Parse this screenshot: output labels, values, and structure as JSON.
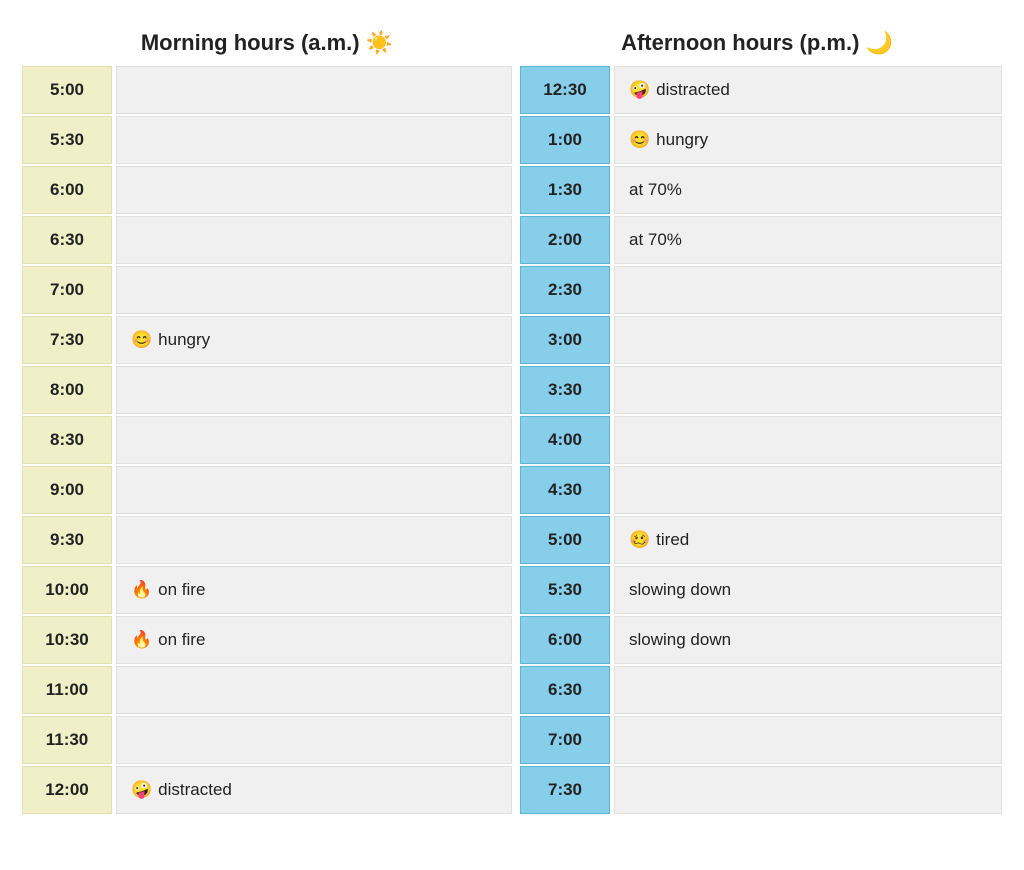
{
  "headers": {
    "morning": "Morning hours (a.m.) ☀️",
    "afternoon": "Afternoon hours (p.m.) 🌙"
  },
  "morning_rows": [
    {
      "time": "5:00",
      "note": "",
      "emoji": ""
    },
    {
      "time": "5:30",
      "note": "",
      "emoji": ""
    },
    {
      "time": "6:00",
      "note": "",
      "emoji": ""
    },
    {
      "time": "6:30",
      "note": "",
      "emoji": ""
    },
    {
      "time": "7:00",
      "note": "",
      "emoji": ""
    },
    {
      "time": "7:30",
      "note": "hungry",
      "emoji": "😊"
    },
    {
      "time": "8:00",
      "note": "",
      "emoji": ""
    },
    {
      "time": "8:30",
      "note": "",
      "emoji": ""
    },
    {
      "time": "9:00",
      "note": "",
      "emoji": ""
    },
    {
      "time": "9:30",
      "note": "",
      "emoji": ""
    },
    {
      "time": "10:00",
      "note": "on fire",
      "emoji": "🔥"
    },
    {
      "time": "10:30",
      "note": "on fire",
      "emoji": "🔥"
    },
    {
      "time": "11:00",
      "note": "",
      "emoji": ""
    },
    {
      "time": "11:30",
      "note": "",
      "emoji": ""
    },
    {
      "time": "12:00",
      "note": "distracted",
      "emoji": "🤪"
    }
  ],
  "afternoon_rows": [
    {
      "time": "12:30",
      "note": "distracted",
      "emoji": "🤪"
    },
    {
      "time": "1:00",
      "note": "hungry",
      "emoji": "😊"
    },
    {
      "time": "1:30",
      "note": "at 70%",
      "emoji": ""
    },
    {
      "time": "2:00",
      "note": "at 70%",
      "emoji": ""
    },
    {
      "time": "2:30",
      "note": "",
      "emoji": ""
    },
    {
      "time": "3:00",
      "note": "",
      "emoji": ""
    },
    {
      "time": "3:30",
      "note": "",
      "emoji": ""
    },
    {
      "time": "4:00",
      "note": "",
      "emoji": ""
    },
    {
      "time": "4:30",
      "note": "",
      "emoji": ""
    },
    {
      "time": "5:00",
      "note": "tired",
      "emoji": "🥴"
    },
    {
      "time": "5:30",
      "note": "slowing down",
      "emoji": ""
    },
    {
      "time": "6:00",
      "note": "slowing down",
      "emoji": ""
    },
    {
      "time": "6:30",
      "note": "",
      "emoji": ""
    },
    {
      "time": "7:00",
      "note": "",
      "emoji": ""
    },
    {
      "time": "7:30",
      "note": "",
      "emoji": ""
    }
  ]
}
